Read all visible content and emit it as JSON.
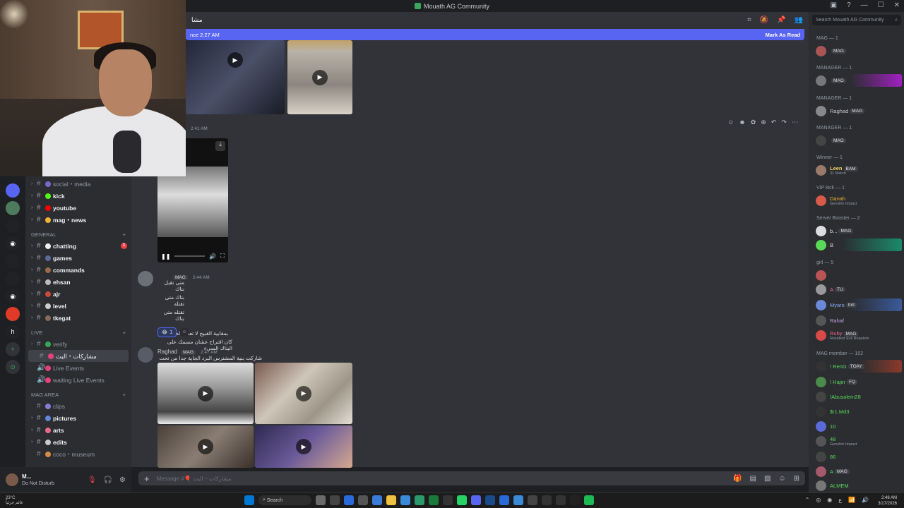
{
  "window": {
    "title": "Mouath AG Community"
  },
  "header": {
    "channel": "مشا"
  },
  "new_bar": {
    "since": "nce 2:27 AM",
    "mark": "Mark As Read"
  },
  "messages": [
    {
      "time": "2:41 AM"
    },
    {
      "time": "2:44 AM",
      "tag": "MAG",
      "lines": [
        "متى تقبل بتاك",
        "بتاك متى تقتله",
        "تقتله متى بتاك",
        "بمقابية القبيح لا تعطم لحيه كرد",
        "كان اقتراح عشان مسمك على البتاك السيء"
      ],
      "reaction_count": "1"
    },
    {
      "author": "Raghad",
      "tag": "MAG",
      "time": "2:47 AM",
      "text": "شاركت بنية المشترس البرد الجاية جدا من تحت"
    }
  ],
  "channels": [
    {
      "name": "social・media",
      "bold": false
    },
    {
      "name": "kick",
      "bold": true
    },
    {
      "name": "youtube",
      "bold": true
    },
    {
      "name": "mag・news",
      "bold": true
    }
  ],
  "categories": {
    "general": "GENERAL",
    "live": "LIVE",
    "mag_area": "MAG AREA"
  },
  "general_channels": [
    {
      "name": "chatting",
      "badge": "1"
    },
    {
      "name": "games"
    },
    {
      "name": "commands"
    },
    {
      "name": "ehsan"
    },
    {
      "name": "ajr"
    },
    {
      "name": "level"
    },
    {
      "name": "tkegat"
    }
  ],
  "live_channels": [
    {
      "name": "verify"
    },
    {
      "name": "مشاركات・البث"
    },
    {
      "name": "Live Events"
    },
    {
      "name": "waiting Live Events"
    }
  ],
  "mag_channels": [
    {
      "name": "clips"
    },
    {
      "name": "pictures"
    },
    {
      "name": "arts"
    },
    {
      "name": "edits"
    },
    {
      "name": "coco・museum"
    }
  ],
  "user": {
    "name": "M...",
    "status": "Do Not Disturb"
  },
  "composer": {
    "placeholder": "Message #🎈 مشاركات・البث"
  },
  "member_search": "Search Mouath AG Community",
  "member_groups": [
    {
      "label": "MAG — 1",
      "members": [
        {
          "name": "",
          "tag": "MAG"
        }
      ]
    },
    {
      "label": "MANAGER — 1",
      "members": [
        {
          "name": "",
          "tag": "MAG"
        }
      ]
    },
    {
      "label": "MANAGER — 1",
      "members": [
        {
          "name": "Raghad",
          "tag": "MAG"
        }
      ]
    },
    {
      "label": "MANAGER — 1",
      "members": [
        {
          "name": "",
          "tag": "MAG"
        }
      ]
    },
    {
      "label": "Winner — 1",
      "members": [
        {
          "name": "Leen",
          "tag": "BAM",
          "sub": "31 March"
        }
      ]
    },
    {
      "label": "VIP kick — 1",
      "members": [
        {
          "name": "Danah",
          "sub": "Genshin Impact"
        }
      ]
    },
    {
      "label": "Server Booster — 2",
      "members": [
        {
          "name": "b...",
          "tag": "MAG"
        },
        {
          "name": "B"
        }
      ]
    },
    {
      "label": "girl — 5",
      "members": [
        {
          "name": ""
        },
        {
          "name": "A",
          "tag": "TU"
        },
        {
          "name": "Myaro",
          "tag": "tmt"
        },
        {
          "name": "Rahaf"
        },
        {
          "name": "Ruby",
          "tag": "MAG",
          "sub": "Resident Evil Requiem"
        }
      ]
    },
    {
      "label": "MAG member — 102",
      "members": [
        {
          "name": "! RenG",
          "tag": "TOAY"
        },
        {
          "name": "! Hajer",
          "tag": "FQ"
        },
        {
          "name": "!Abusalem28"
        },
        {
          "name": "$r1.Md3"
        },
        {
          "name": "10"
        },
        {
          "name": "48",
          "sub": "Genshin Impact"
        },
        {
          "name": "86"
        },
        {
          "name": "A",
          "tag": "MAG"
        },
        {
          "name": "ALMEM"
        }
      ]
    }
  ],
  "taskbar": {
    "temp": "23°C",
    "weather": "غائم جزئياً",
    "search": "Search",
    "time": "2:48 AM",
    "date": "3/17/2026"
  },
  "colors": {
    "blurple": "#5865f2",
    "bg": "#313338",
    "sidebar": "#2b2d31"
  }
}
